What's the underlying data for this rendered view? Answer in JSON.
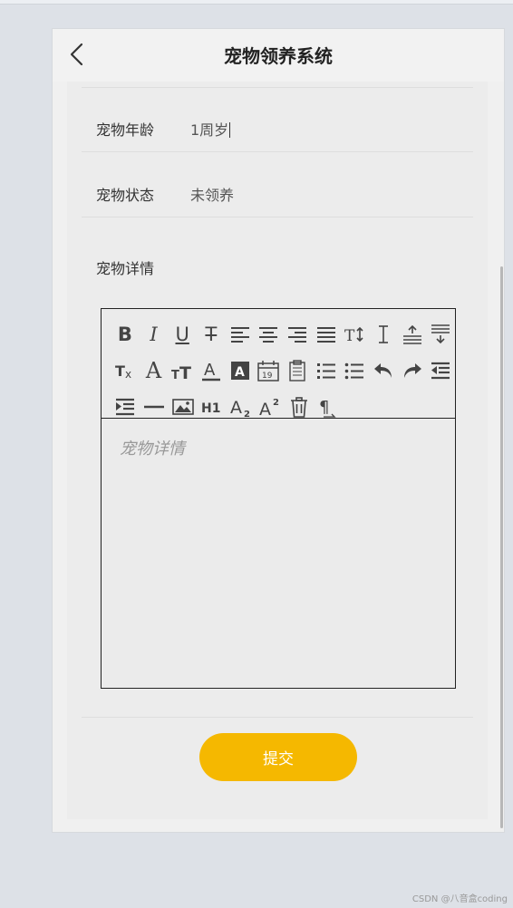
{
  "header": {
    "title": "宠物领养系统"
  },
  "form": {
    "age_label": "宠物年龄",
    "age_value": "1周岁",
    "status_label": "宠物状态",
    "status_value": "未领养",
    "detail_label": "宠物详情"
  },
  "editor": {
    "placeholder": "宠物详情",
    "toolbar": [
      [
        "bold-icon",
        "italic-icon",
        "underline-icon",
        "strikethrough-icon",
        "align-left-icon",
        "align-center-icon",
        "align-right-icon",
        "align-justify-icon",
        "font-size-icon",
        "line-height-icon",
        "paragraph-before-icon",
        "paragraph-after-icon"
      ],
      [
        "clear-format-icon",
        "font-family-icon",
        "text-size-icon",
        "font-color-icon",
        "background-color-icon",
        "date-icon",
        "paste-icon",
        "ordered-list-icon",
        "unordered-list-icon",
        "undo-icon",
        "redo-icon",
        "outdent-icon"
      ],
      [
        "indent-icon",
        "horizontal-line-icon",
        "image-icon",
        "heading-icon",
        "subscript-icon",
        "superscript-icon",
        "delete-icon",
        "paragraph-mark-icon"
      ]
    ]
  },
  "actions": {
    "submit_label": "提交"
  },
  "watermark": "CSDN @八音盒coding",
  "colors": {
    "accent": "#f5b800",
    "background": "#dde1e7",
    "panel": "#ececec"
  }
}
